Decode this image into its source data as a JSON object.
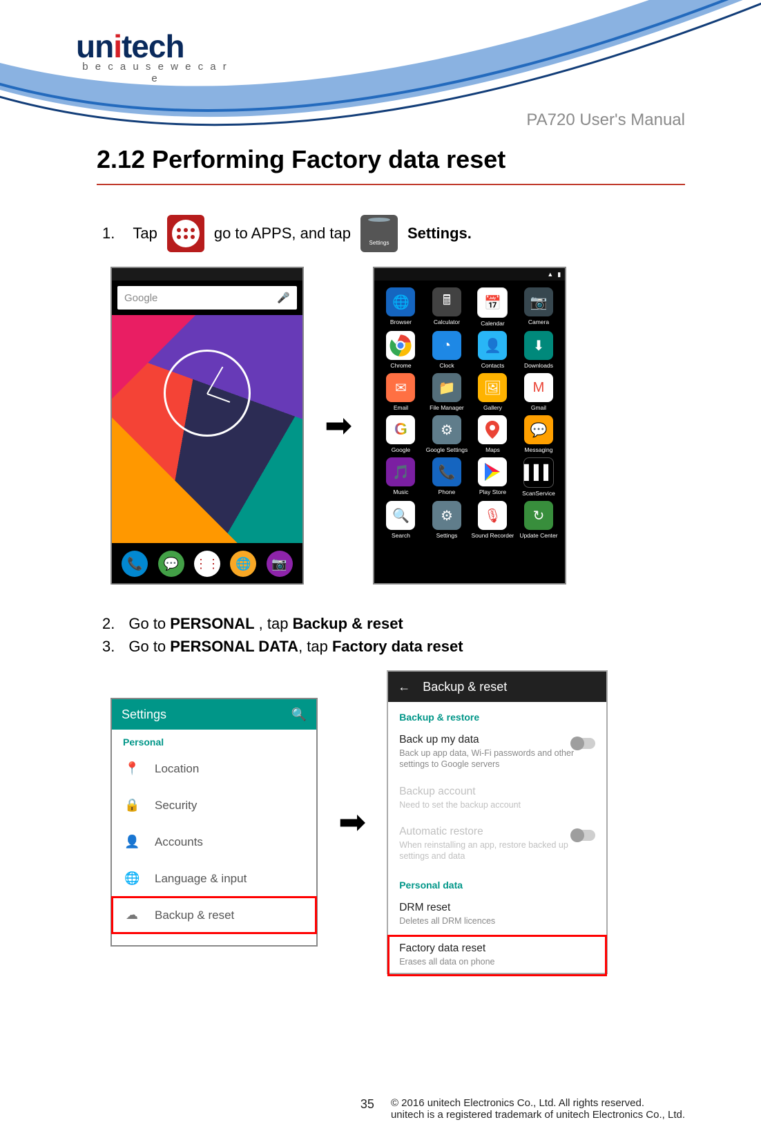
{
  "logo": {
    "brand_pre": "un",
    "brand_i": "i",
    "brand_post": "tech",
    "tagline": "b e c a u s e   w e   c a r e"
  },
  "manual_title": "PA720 User's Manual",
  "section_heading": "2.12 Performing Factory data reset",
  "step1": {
    "num": "1.",
    "a": "Tap",
    "b": "go to APPS, and tap",
    "c": "Settings.",
    "settings_icon_label": "Settings"
  },
  "phone1": {
    "search_placeholder": "Google",
    "mic": "🎤"
  },
  "phone2": {
    "status": {
      "battery": "▮",
      "signal": "▲"
    },
    "apps": [
      {
        "label": "Browser",
        "cls": "c-globe",
        "glyph": "🌐"
      },
      {
        "label": "Calculator",
        "cls": "c-calc",
        "glyph": "🖩"
      },
      {
        "label": "Calendar",
        "cls": "c-cal",
        "glyph": "📅"
      },
      {
        "label": "Camera",
        "cls": "c-cam",
        "glyph": "📷"
      },
      {
        "label": "Chrome",
        "cls": "c-chrome",
        "glyph": "chrome"
      },
      {
        "label": "Clock",
        "cls": "c-clock",
        "glyph": "◔"
      },
      {
        "label": "Contacts",
        "cls": "c-contacts",
        "glyph": "👤"
      },
      {
        "label": "Downloads",
        "cls": "c-dl",
        "glyph": "⬇"
      },
      {
        "label": "Email",
        "cls": "c-email",
        "glyph": "✉"
      },
      {
        "label": "File Manager",
        "cls": "c-file",
        "glyph": "📁"
      },
      {
        "label": "Gallery",
        "cls": "c-gallery",
        "glyph": "🖼"
      },
      {
        "label": "Gmail",
        "cls": "c-gmail",
        "glyph": "M"
      },
      {
        "label": "Google",
        "cls": "c-google",
        "glyph": "G"
      },
      {
        "label": "Google Settings",
        "cls": "c-gset",
        "glyph": "⚙"
      },
      {
        "label": "Maps",
        "cls": "c-maps",
        "glyph": "📍"
      },
      {
        "label": "Messaging",
        "cls": "c-msg",
        "glyph": "💬"
      },
      {
        "label": "Music",
        "cls": "c-music",
        "glyph": "🎵"
      },
      {
        "label": "Phone",
        "cls": "c-phone",
        "glyph": "📞"
      },
      {
        "label": "Play Store",
        "cls": "c-play",
        "glyph": "▶"
      },
      {
        "label": "ScanService",
        "cls": "c-scan",
        "glyph": "▌▌▌"
      },
      {
        "label": "Search",
        "cls": "c-search",
        "glyph": "🔍"
      },
      {
        "label": "Settings",
        "cls": "c-settings",
        "glyph": "⚙"
      },
      {
        "label": "Sound Recorder",
        "cls": "c-sound",
        "glyph": "🎙"
      },
      {
        "label": "Update Center",
        "cls": "c-update",
        "glyph": "↻"
      }
    ]
  },
  "step2": {
    "num": "2.",
    "a": "Go to ",
    "b": "PERSONAL",
    "c": " , tap ",
    "d": "Backup & reset"
  },
  "step3": {
    "num": "3.",
    "a": "Go to ",
    "b": "PERSONAL DATA",
    "c": ", tap ",
    "d": "Factory data reset"
  },
  "phone3": {
    "title": "Settings",
    "search": "🔍",
    "section": "Personal",
    "items": [
      {
        "icon": "📍",
        "label": "Location",
        "name": "location",
        "cls": ""
      },
      {
        "icon": "🔒",
        "label": "Security",
        "name": "security",
        "cls": ""
      },
      {
        "icon": "👤",
        "label": "Accounts",
        "name": "accounts",
        "cls": ""
      },
      {
        "icon": "🌐",
        "label": "Language & input",
        "name": "language-input",
        "cls": ""
      },
      {
        "icon": "☁",
        "label": "Backup & reset",
        "name": "backup-reset",
        "cls": "hl"
      }
    ]
  },
  "phone4": {
    "back": "←",
    "title": "Backup & reset",
    "sect1": "Backup & restore",
    "i1": {
      "t": "Back up my data",
      "s": "Back up app data, Wi-Fi passwords and other settings to Google servers"
    },
    "i2": {
      "t": "Backup account",
      "s": "Need to set the backup account"
    },
    "i3": {
      "t": "Automatic restore",
      "s": "When reinstalling an app, restore backed up settings and data"
    },
    "sect2": "Personal data",
    "i4": {
      "t": "DRM reset",
      "s": "Deletes all DRM licences"
    },
    "i5": {
      "t": "Factory data reset",
      "s": "Erases all data on phone"
    }
  },
  "footer": {
    "page": "35",
    "line1": "© 2016 unitech Electronics Co., Ltd. All rights reserved.",
    "line2": "unitech is a registered trademark of unitech Electronics Co., Ltd."
  }
}
